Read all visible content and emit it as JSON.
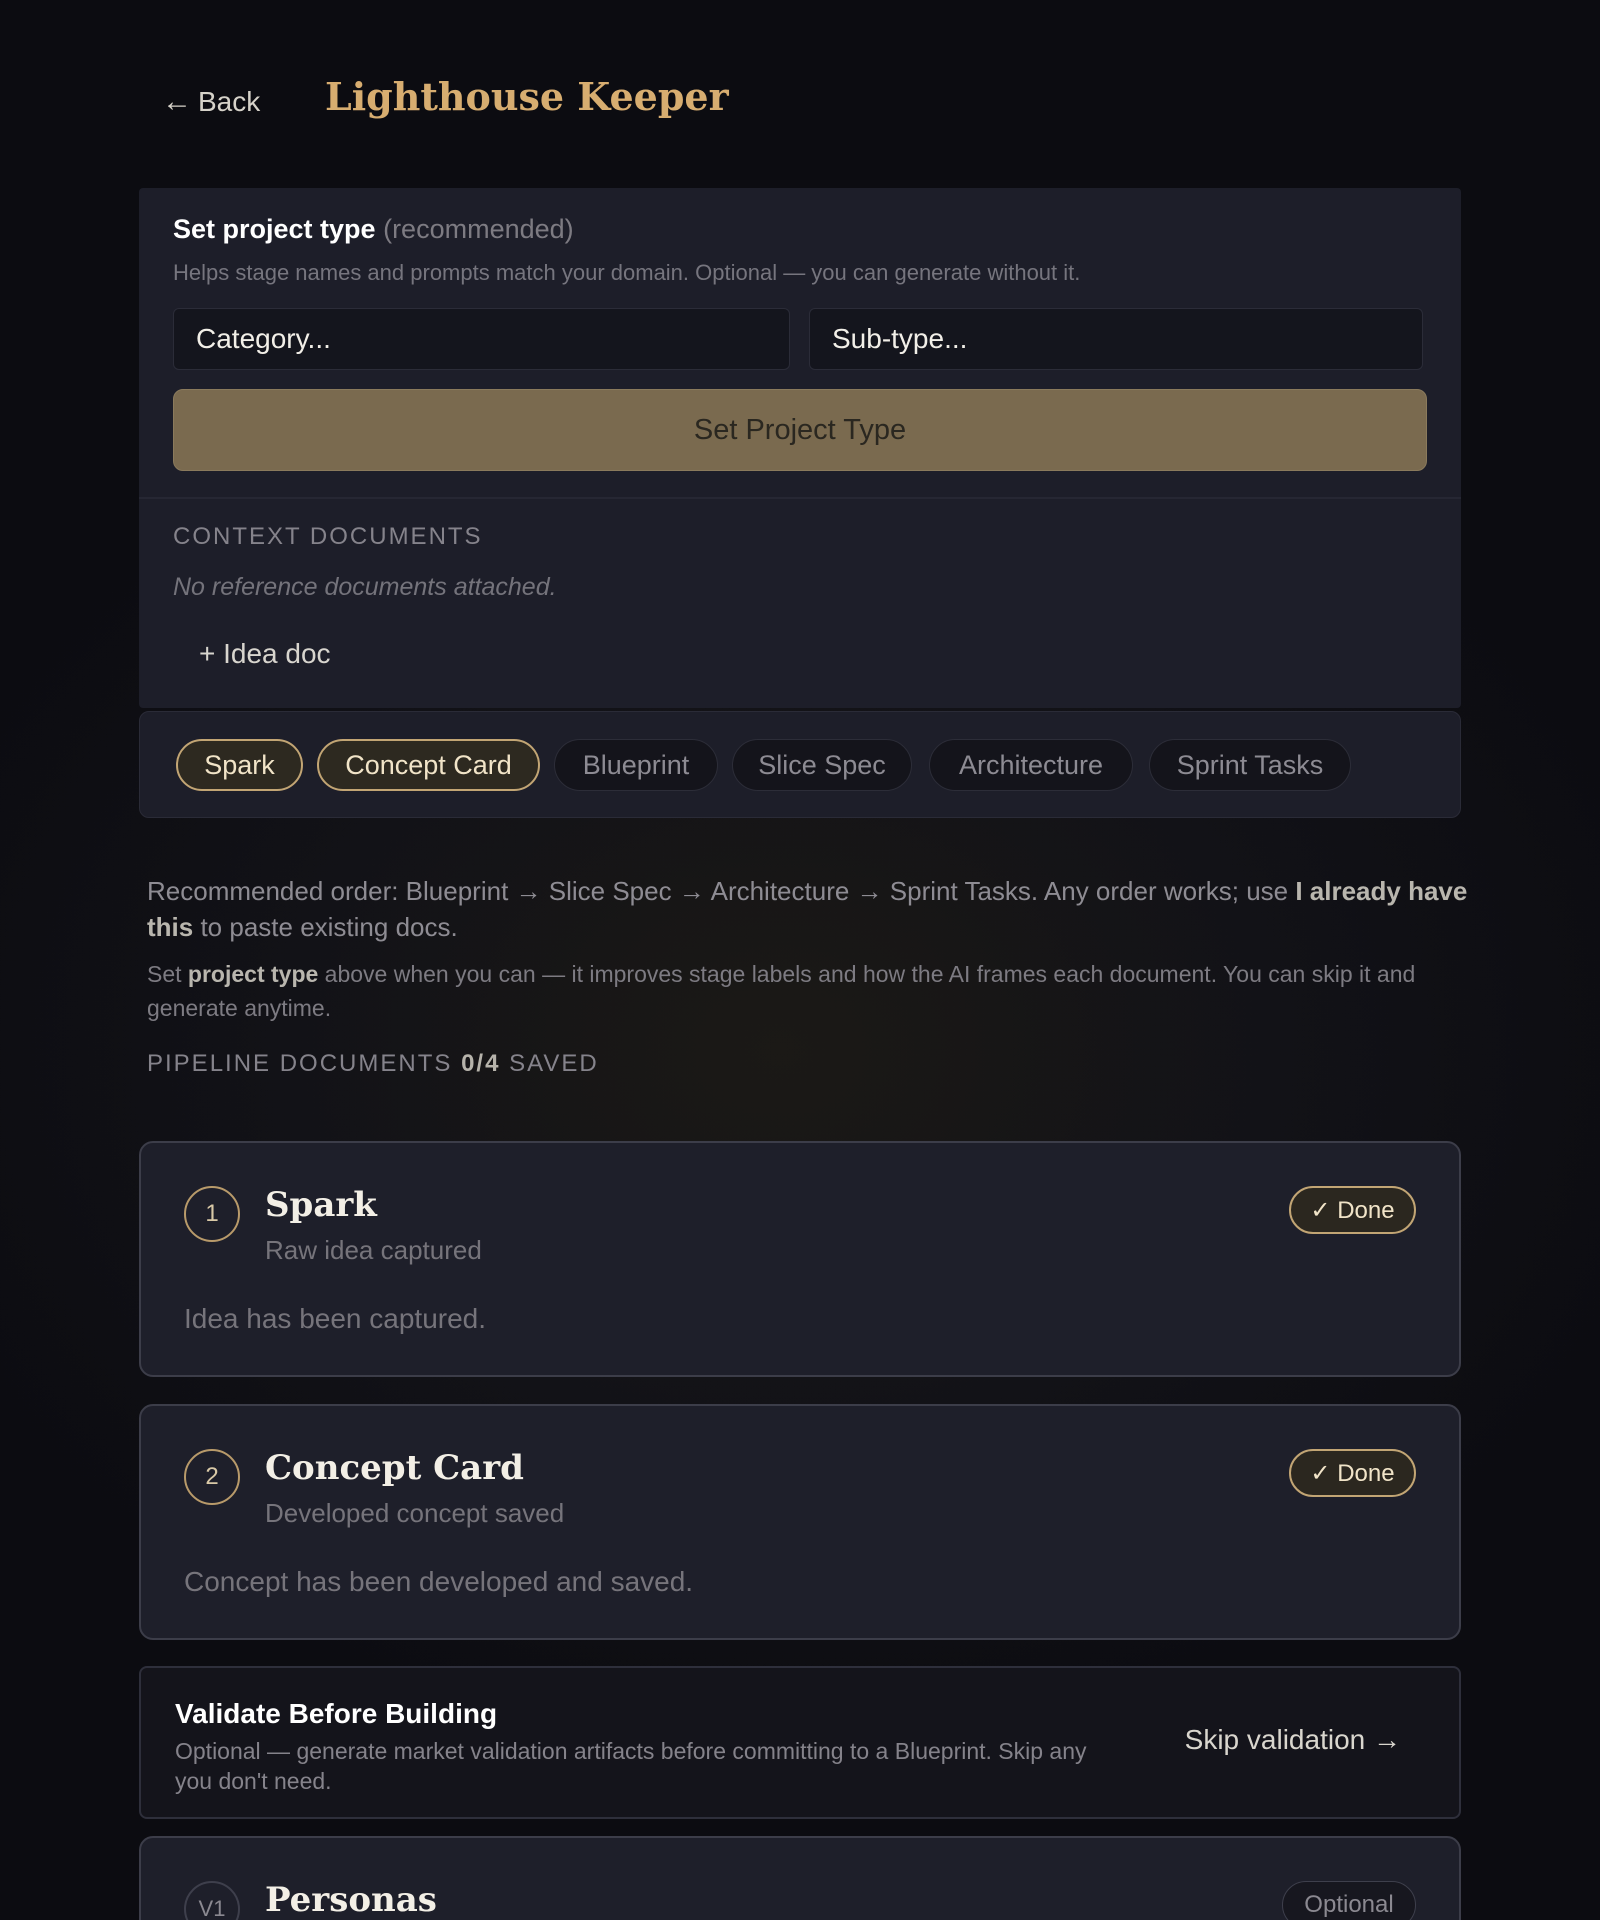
{
  "header": {
    "back_label": "Back",
    "back_arrow": "←",
    "title": "Lighthouse Keeper"
  },
  "project_type": {
    "title": "Set project type",
    "recommended": "(recommended)",
    "help": "Helps stage names and prompts match your domain. Optional — you can generate without it.",
    "category_placeholder": "Category...",
    "subtype_placeholder": "Sub-type...",
    "button_label": "Set Project Type"
  },
  "context": {
    "label": "CONTEXT DOCUMENTS",
    "empty": "No reference documents attached.",
    "add_button": "+ Idea doc"
  },
  "tabs": [
    {
      "label": "Spark",
      "state": "done"
    },
    {
      "label": "Concept Card",
      "state": "done"
    },
    {
      "label": "Blueprint",
      "state": "todo"
    },
    {
      "label": "Slice Spec",
      "state": "todo"
    },
    {
      "label": "Architecture",
      "state": "todo"
    },
    {
      "label": "Sprint Tasks",
      "state": "todo"
    }
  ],
  "info": {
    "rec_prefix": "Recommended order: Blueprint → Slice Spec → Architecture → Sprint Tasks. Any order works; use ",
    "rec_bold": "I already have this",
    "rec_suffix": " to paste existing docs.",
    "note_prefix": "Set ",
    "note_bold": "project type",
    "note_suffix": " above when you can — it improves stage labels and how the AI frames each document. You can skip it and generate anytime.",
    "pipeline_label": "PIPELINE DOCUMENTS",
    "pipeline_count": "0/4",
    "pipeline_suffix": "SAVED"
  },
  "stages": [
    {
      "number": "1",
      "title": "Spark",
      "subtitle": "Raw idea captured",
      "body": "Idea has been captured.",
      "badge": "✓ Done"
    },
    {
      "number": "2",
      "title": "Concept Card",
      "subtitle": "Developed concept saved",
      "body": "Concept has been developed and saved.",
      "badge": "✓ Done"
    }
  ],
  "validate": {
    "title": "Validate Before Building",
    "desc": "Optional — generate market validation artifacts before committing to a Blueprint. Skip any you don't need.",
    "skip_label": "Skip validation →"
  },
  "personas": {
    "number": "V1",
    "title": "Personas",
    "badge": "Optional"
  },
  "colors": {
    "accent": "#d7ad70",
    "background": "#0c0c11",
    "panel": "#1d1e29",
    "button": "#7a6a4f"
  }
}
